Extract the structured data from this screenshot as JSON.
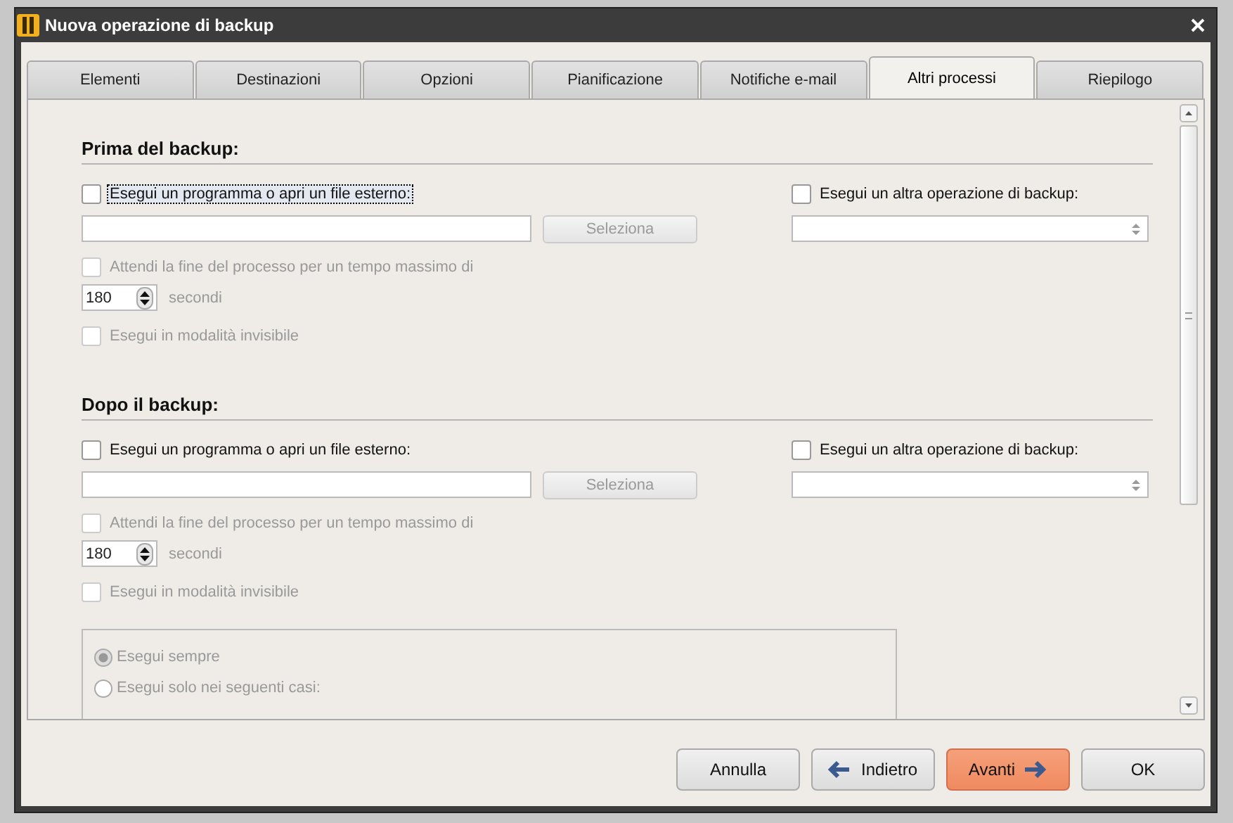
{
  "window": {
    "title": "Nuova operazione di backup"
  },
  "tabs": [
    {
      "label": "Elementi",
      "selected": false
    },
    {
      "label": "Destinazioni",
      "selected": false
    },
    {
      "label": "Opzioni",
      "selected": false
    },
    {
      "label": "Pianificazione",
      "selected": false
    },
    {
      "label": "Notifiche e-mail",
      "selected": false
    },
    {
      "label": "Altri processi",
      "selected": true
    },
    {
      "label": "Riepilogo",
      "selected": false
    }
  ],
  "sections": [
    {
      "heading": "Prima del backup:",
      "run_program": {
        "label": "Esegui un programma o apri un file esterno:",
        "checked": false,
        "focused": true
      },
      "select_button": {
        "label": "Seleziona",
        "disabled": true
      },
      "wait": {
        "label": "Attendi la fine del processo per un tempo massimo di",
        "checked": false,
        "disabled": true
      },
      "timeout": {
        "value": "180",
        "unit": "secondi",
        "disabled": true
      },
      "invisible": {
        "label": "Esegui in modalità invisibile",
        "checked": false,
        "disabled": true
      },
      "other_backup": {
        "label": "Esegui un altra operazione di backup:",
        "checked": false
      }
    },
    {
      "heading": "Dopo il backup:",
      "run_program": {
        "label": "Esegui un programma o apri un file esterno:",
        "checked": false,
        "focused": false
      },
      "select_button": {
        "label": "Seleziona",
        "disabled": true
      },
      "wait": {
        "label": "Attendi la fine del processo per un tempo massimo di",
        "checked": false,
        "disabled": true
      },
      "timeout": {
        "value": "180",
        "unit": "secondi",
        "disabled": true
      },
      "invisible": {
        "label": "Esegui in modalità invisibile",
        "checked": false,
        "disabled": true
      },
      "other_backup": {
        "label": "Esegui un altra operazione di backup:",
        "checked": false
      }
    }
  ],
  "run_condition": {
    "options": [
      {
        "label": "Esegui sempre",
        "selected": true,
        "disabled": true
      },
      {
        "label": "Esegui solo nei seguenti casi:",
        "selected": false,
        "disabled": true
      }
    ]
  },
  "buttons": [
    {
      "label": "Annulla",
      "kind": "plain"
    },
    {
      "label": "Indietro",
      "kind": "back"
    },
    {
      "label": "Avanti",
      "kind": "next"
    },
    {
      "label": "OK",
      "kind": "plain"
    }
  ]
}
